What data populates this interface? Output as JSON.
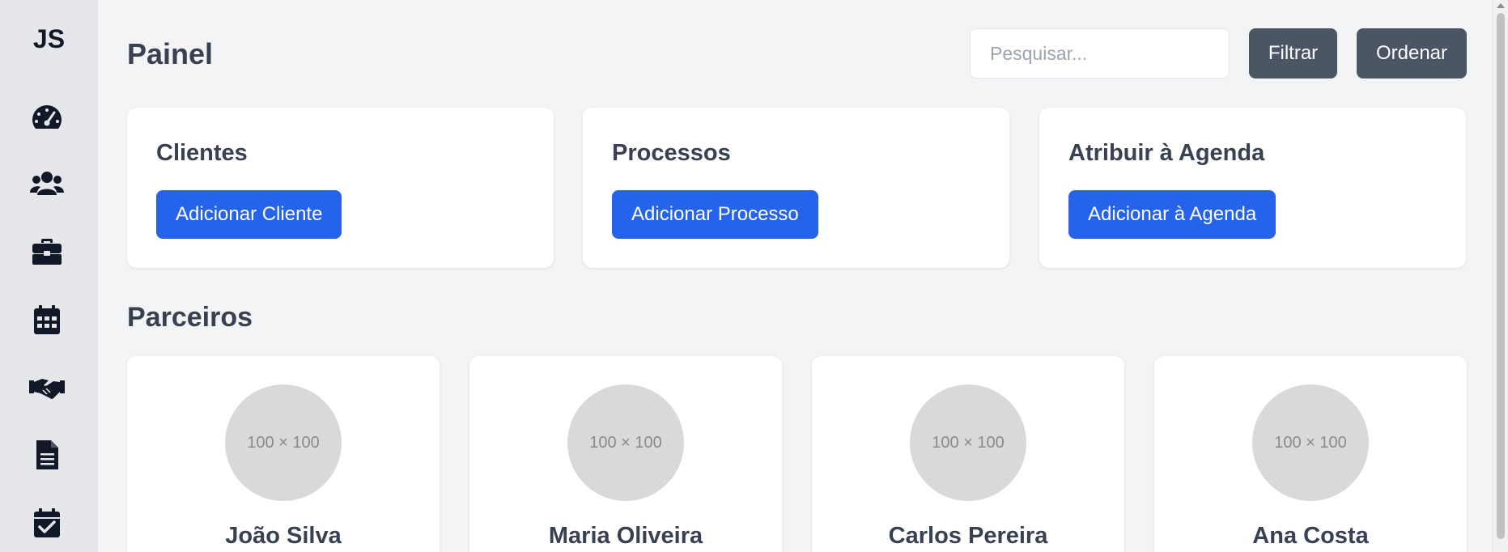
{
  "sidebar": {
    "logo": "JS",
    "items": [
      {
        "icon": "dashboard-gauge-icon"
      },
      {
        "icon": "users-icon"
      },
      {
        "icon": "briefcase-icon"
      },
      {
        "icon": "calendar-icon"
      },
      {
        "icon": "handshake-icon"
      },
      {
        "icon": "document-icon"
      },
      {
        "icon": "calendar-check-icon"
      }
    ]
  },
  "header": {
    "title": "Painel",
    "search_placeholder": "Pesquisar...",
    "filter_label": "Filtrar",
    "sort_label": "Ordenar"
  },
  "cards": [
    {
      "title": "Clientes",
      "button": "Adicionar Cliente"
    },
    {
      "title": "Processos",
      "button": "Adicionar Processo"
    },
    {
      "title": "Atribuir à Agenda",
      "button": "Adicionar à Agenda"
    }
  ],
  "partners": {
    "title": "Parceiros",
    "items": [
      {
        "name": "João Silva",
        "avatar_text": "100 × 100"
      },
      {
        "name": "Maria Oliveira",
        "avatar_text": "100 × 100"
      },
      {
        "name": "Carlos Pereira",
        "avatar_text": "100 × 100"
      },
      {
        "name": "Ana Costa",
        "avatar_text": "100 × 100"
      }
    ]
  },
  "colors": {
    "primary": "#2563eb",
    "dark_button": "#4b5563",
    "sidebar_bg": "#e5e7eb",
    "page_bg": "#f3f4f6"
  }
}
